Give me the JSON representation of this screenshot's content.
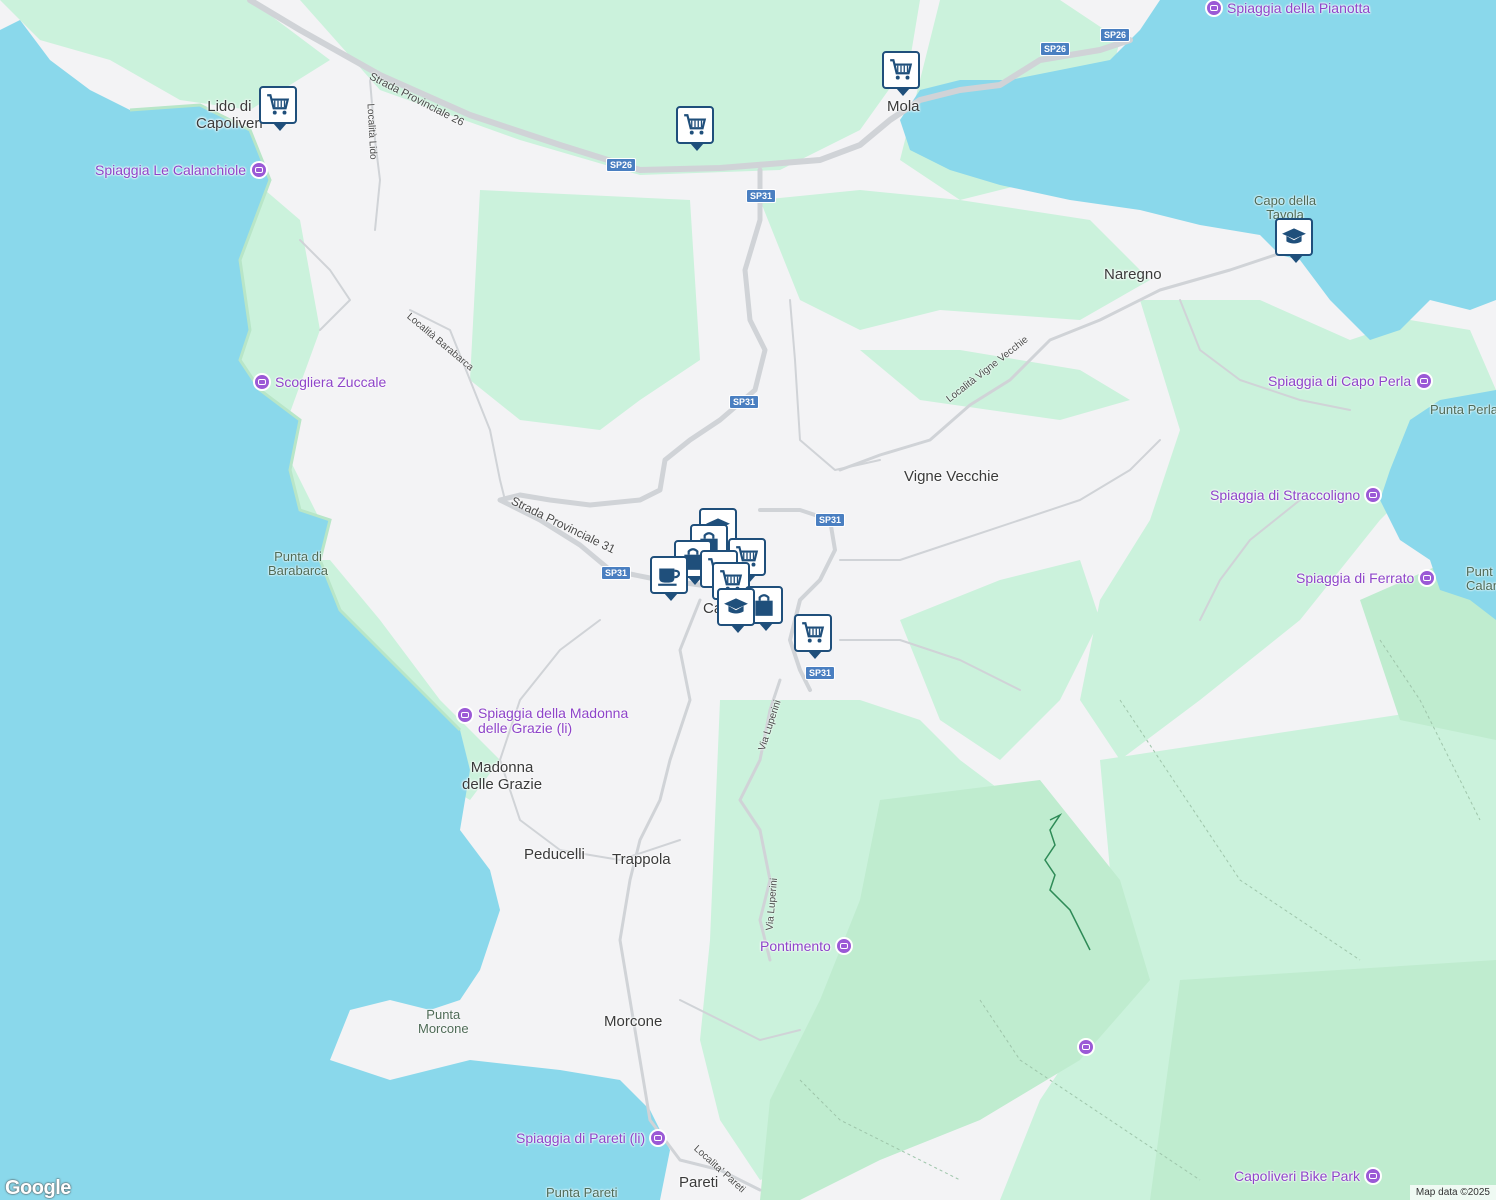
{
  "colors": {
    "water": "#8ad8eb",
    "land": "#f3f3f5",
    "vegetation": "#cbf2dc",
    "park": "#bfeccf",
    "road": "#d0d3d7",
    "highway_shield": "#4a7fc1",
    "poi": "#9b59d6",
    "marker": "#1f4f7b"
  },
  "places": [
    {
      "name": "Lido di\nCapoliveri"
    },
    {
      "name": "Mola"
    },
    {
      "name": "Naregno"
    },
    {
      "name": "Vigne Vecchie"
    },
    {
      "name": "Madonna\ndelle Grazie"
    },
    {
      "name": "Peducelli"
    },
    {
      "name": "Trappola"
    },
    {
      "name": "Morcone"
    },
    {
      "name": "Pareti"
    },
    {
      "name": "Ca"
    }
  ],
  "natural_features": [
    {
      "name": "Punta di\nBarabarca"
    },
    {
      "name": "Punta\nMorcone"
    },
    {
      "name": "Punta Pareti"
    },
    {
      "name": "Capo della\nTavola"
    },
    {
      "name": "Punta Perla"
    },
    {
      "name": "Punt\nCalan"
    }
  ],
  "roads": [
    {
      "name": "Strada Provinciale 26"
    },
    {
      "name": "Strada Provinciale 31"
    },
    {
      "name": "Località Lido"
    },
    {
      "name": "Località Barabarca"
    },
    {
      "name": "Località Vigne Vecchie"
    },
    {
      "name": "Via Luperini"
    },
    {
      "name": "Via Luperini"
    },
    {
      "name": "Localita' Pareti"
    }
  ],
  "shields": [
    "SP26",
    "SP26",
    "SP26",
    "SP31",
    "SP31",
    "SP31",
    "SP31",
    "SP31"
  ],
  "pois": [
    {
      "name": "Spiaggia della Pianotta"
    },
    {
      "name": "Spiaggia Le Calanchiole"
    },
    {
      "name": "Scogliera Zuccale"
    },
    {
      "name": "Spiaggia della Madonna\ndelle Grazie (li)"
    },
    {
      "name": "Spiaggia di Capo Perla"
    },
    {
      "name": "Spiaggia di Straccoligno"
    },
    {
      "name": "Spiaggia di Ferrato"
    },
    {
      "name": "Pontimento"
    },
    {
      "name": "Spiaggia di Pareti (li)"
    },
    {
      "name": "Capoliveri Bike Park"
    },
    {
      "name": ""
    }
  ],
  "markers": [
    {
      "icon": "shopping-cart-icon"
    },
    {
      "icon": "shopping-cart-icon"
    },
    {
      "icon": "shopping-cart-icon"
    },
    {
      "icon": "shopping-cart-icon"
    },
    {
      "icon": "graduation-cap-icon"
    },
    {
      "icon": "graduation-cap-icon"
    },
    {
      "icon": "graduation-cap-icon"
    },
    {
      "icon": "coffee-cup-icon"
    },
    {
      "icon": "shopping-bag-icon"
    },
    {
      "icon": "shopping-bag-icon"
    },
    {
      "icon": "shopping-bag-icon"
    },
    {
      "icon": "shopping-cart-icon"
    },
    {
      "icon": "shopping-cart-icon"
    },
    {
      "icon": "shopping-cart-icon"
    }
  ],
  "google_logo": "Google",
  "attribution": "Map data ©2025"
}
